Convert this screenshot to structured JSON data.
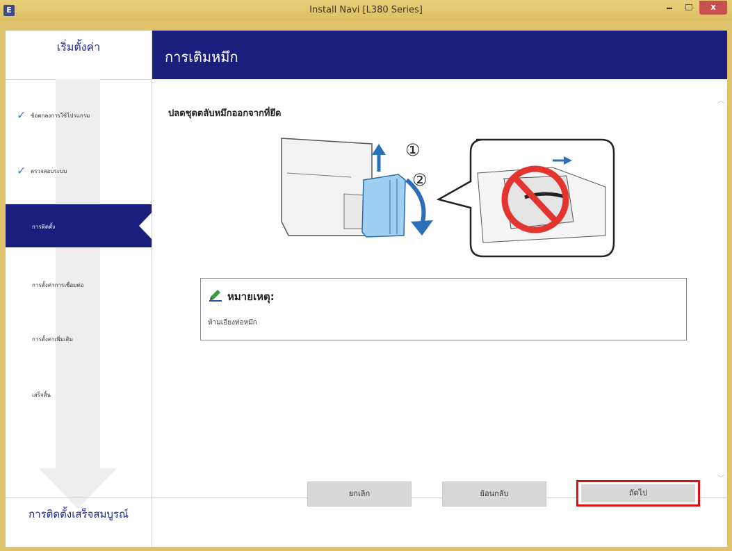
{
  "window": {
    "title": "Install Navi [L380 Series]",
    "app_icon_letter": "E",
    "close_glyph": "x",
    "min_icon": "minimize-icon",
    "max_icon": "maximize-icon",
    "close_icon": "close-icon"
  },
  "sidebar": {
    "heading": "เริ่มตั้งค่า",
    "steps": [
      {
        "label": "ข้อตกลงการใช้โปรแกรม",
        "done": true
      },
      {
        "label": "ตรวจสอบระบบ",
        "done": true
      },
      {
        "label": "การติดตั้ง",
        "active": true
      },
      {
        "label": "การตั้งค่าการเชื่อมต่อ",
        "done": false
      },
      {
        "label": "การตั้งค่าเพิ่มเติม",
        "done": false
      },
      {
        "label": "เสร็จสิ้น",
        "done": false
      }
    ],
    "footer": "การติดตั้งเสร็จสมบูรณ์",
    "check_glyph": "✓"
  },
  "header": {
    "title": "การเติมหมึก"
  },
  "content": {
    "instruction": "ปลดชุดตลับหมึกออกจากที่ยึด",
    "step_markers": [
      "①",
      "②"
    ],
    "note": {
      "title": "หมายเหตุ:",
      "text": "ห้ามเอียงท่อหมึก",
      "icon": "pencil-note-icon"
    }
  },
  "buttons": {
    "cancel": "ยกเลิก",
    "back": "ย้อนกลับ",
    "next": "ถัดไป"
  },
  "colors": {
    "accent_navy": "#1a1f7d",
    "titlebar": "#dfc36a",
    "highlight_red": "#e01010"
  }
}
